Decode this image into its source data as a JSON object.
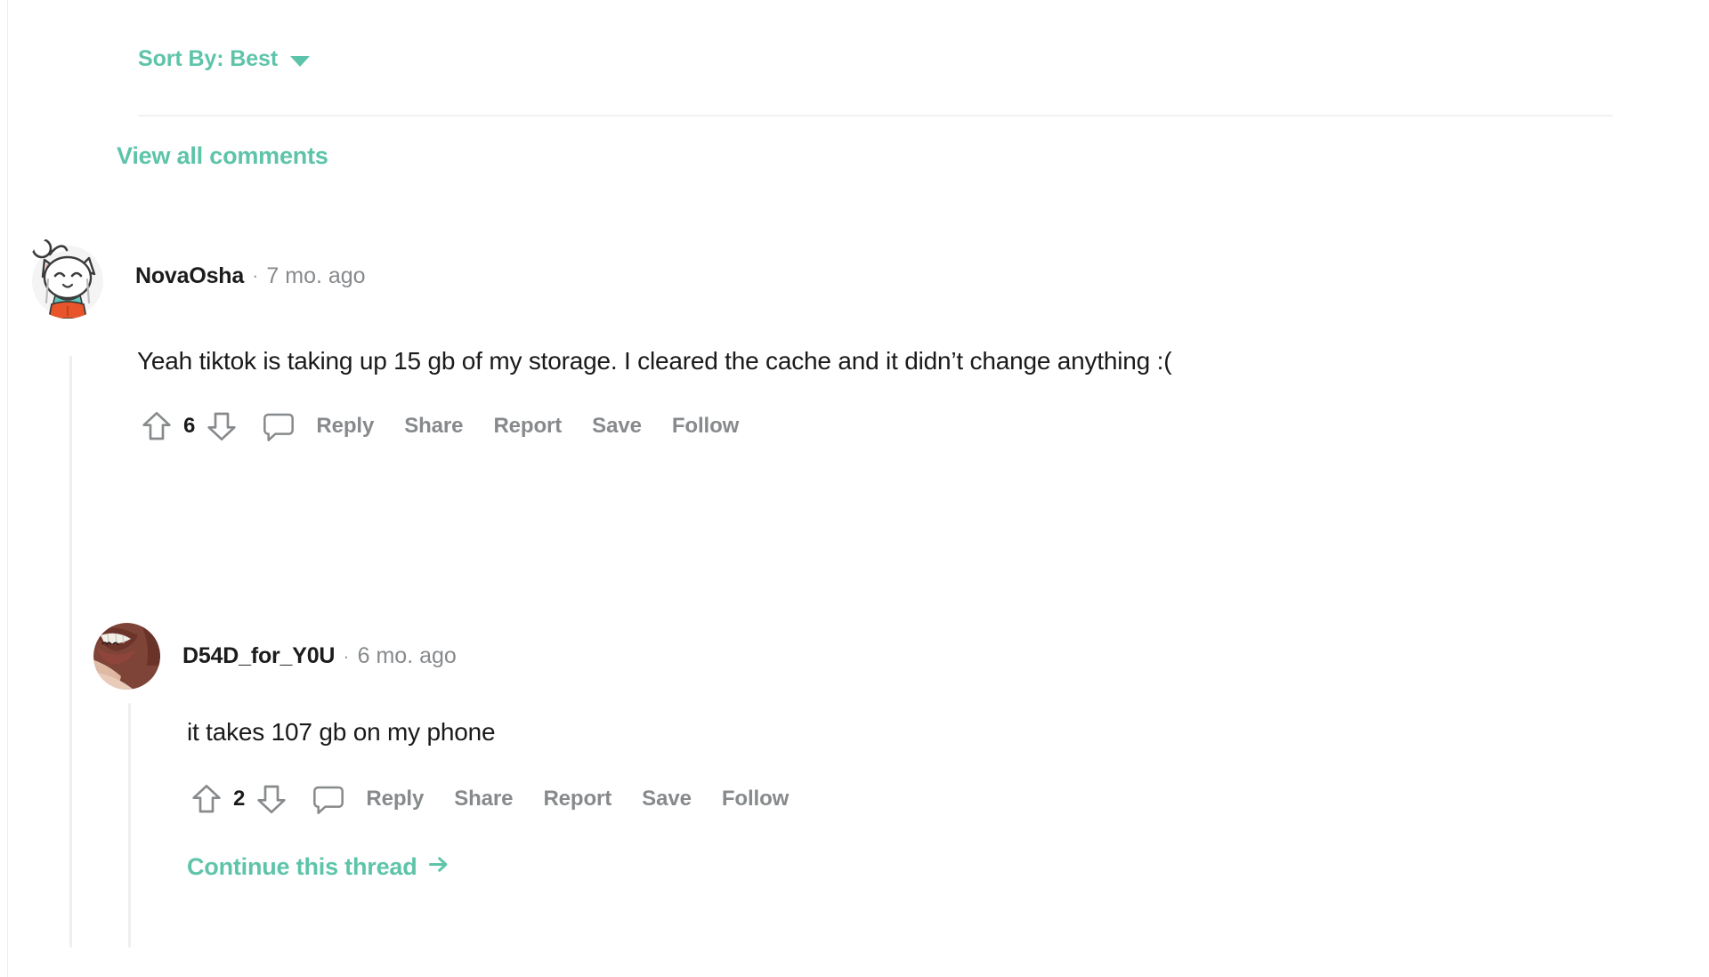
{
  "sort": {
    "label": "Sort By: Best",
    "caret_icon": "chevron-down-icon"
  },
  "view_all_label": "View all comments",
  "colors": {
    "accent": "#5ec4a9",
    "text": "#1a1a1b",
    "muted": "#878a8c",
    "thread_line": "#edeff1",
    "divider": "#f0f1f2"
  },
  "comments": [
    {
      "avatar_icon": "avatar-cat-character",
      "username": "NovaOsha",
      "separator": "·",
      "timestamp": "7 mo. ago",
      "body": "Yeah tiktok is taking up 15 gb of my storage. I cleared the cache and it didn’t change anything :(",
      "score": "6",
      "upvote_icon": "upvote-arrow-icon",
      "downvote_icon": "downvote-arrow-icon",
      "reply_bubble_icon": "comment-bubble-icon",
      "actions": [
        "Reply",
        "Share",
        "Report",
        "Save",
        "Follow"
      ]
    },
    {
      "avatar_icon": "avatar-lips-photo",
      "username": "D54D_for_Y0U",
      "separator": "·",
      "timestamp": "6 mo. ago",
      "body": "it takes 107 gb on my phone",
      "score": "2",
      "upvote_icon": "upvote-arrow-icon",
      "downvote_icon": "downvote-arrow-icon",
      "reply_bubble_icon": "comment-bubble-icon",
      "actions": [
        "Reply",
        "Share",
        "Report",
        "Save",
        "Follow"
      ],
      "continue_thread_label": "Continue this thread",
      "continue_thread_arrow": "arrow-right-icon"
    }
  ]
}
